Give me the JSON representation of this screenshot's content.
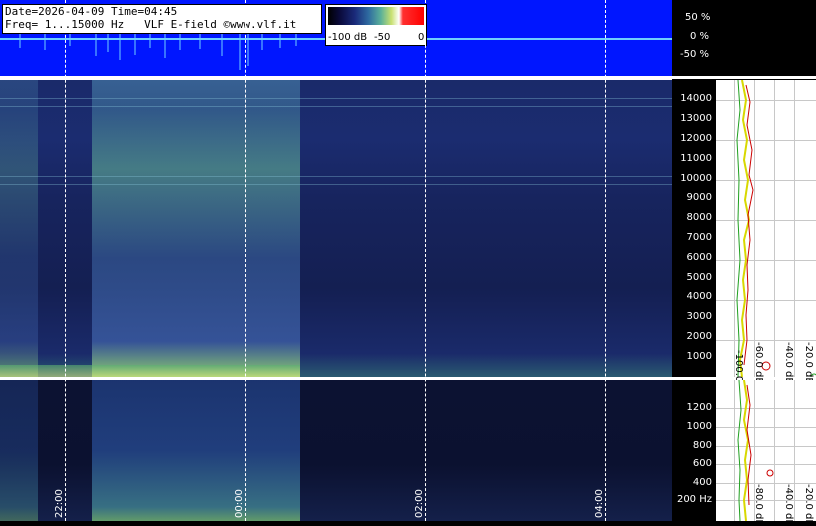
{
  "header": {
    "date_line": "Date=2026-04-09 Time=04:45",
    "freq_line": "Freq= 1...15000 Hz   VLF E-field ©www.vlf.it"
  },
  "colorbar": {
    "labels": [
      "-100 dB",
      "-50",
      "0"
    ],
    "colors": [
      "#000000",
      "#1a2a7a",
      "#5ab09a",
      "#ffffff",
      "#ff0000"
    ]
  },
  "amplitude_axis": [
    "50 %",
    "0 %",
    "-50 %"
  ],
  "upper_freq_ticks": [
    "14000",
    "13000",
    "12000",
    "11000",
    "10000",
    "9000",
    "8000",
    "7000",
    "6000",
    "5000",
    "4000",
    "3000",
    "2000",
    "1000"
  ],
  "lower_freq_ticks": [
    "1200",
    "1000",
    "800",
    "600",
    "400",
    "200 Hz"
  ],
  "time_labels": [
    "22:00",
    "00:00",
    "02:00",
    "04:00"
  ],
  "spectrum_db_labels": [
    "-100.0 dB",
    "-80.0 dB",
    "-60.0 dB",
    "-40.0 dB",
    "-20.0 dB"
  ],
  "colors": {
    "waveform_bg": "#0016ff",
    "waveform_trace": "#6fd0ff",
    "spectrum_trace_avg": "#d8d800",
    "spectrum_trace_peak": "#cc0000",
    "spectrum_trace_min": "#20a020"
  }
}
